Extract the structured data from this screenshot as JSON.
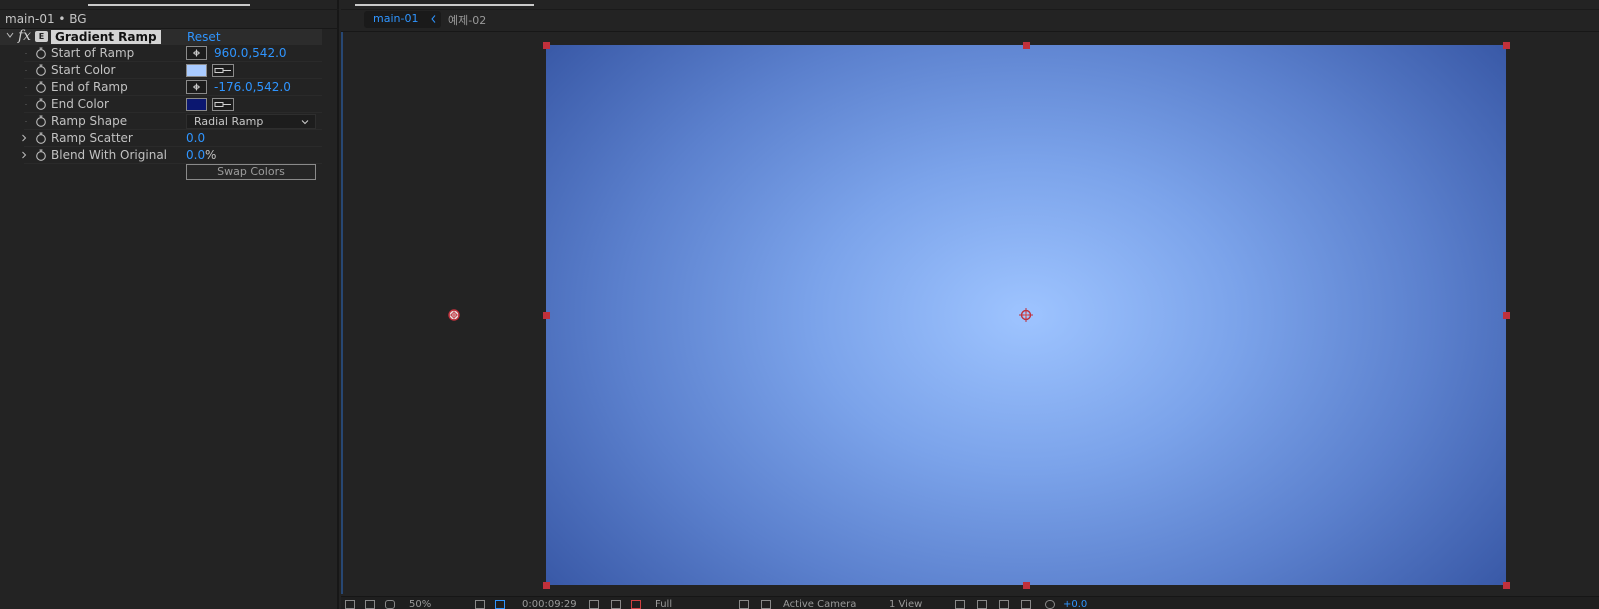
{
  "effect_panel": {
    "layer_title": "main-01 • BG",
    "effect": {
      "name": "Gradient Ramp",
      "reset_label": "Reset",
      "badge": "fx",
      "badge_icon": "effect-badge-icon"
    },
    "properties": {
      "start_of_ramp": {
        "label": "Start of Ramp",
        "value": "960.0,542.0"
      },
      "start_color": {
        "label": "Start Color",
        "color": "#a9cbff"
      },
      "end_of_ramp": {
        "label": "End of Ramp",
        "value": "-176.0,542.0"
      },
      "end_color": {
        "label": "End Color",
        "color": "#0b1770"
      },
      "ramp_shape": {
        "label": "Ramp Shape",
        "value": "Radial Ramp"
      },
      "ramp_scatter": {
        "label": "Ramp Scatter",
        "value": "0.0"
      },
      "blend_with_original": {
        "label": "Blend With Original",
        "value": "0.0",
        "unit": "%"
      }
    },
    "swap_colors_label": "Swap Colors"
  },
  "viewer": {
    "tabs": [
      {
        "label": "main-01",
        "active": true
      },
      {
        "label": "예제-02",
        "active": false
      }
    ],
    "bottom_bar": {
      "zoom": "50%",
      "timecode": "0:00:09:29",
      "resolution": "Full",
      "camera": "Active Camera",
      "views": "1 View",
      "exposure": "+0.0"
    }
  },
  "colors": {
    "accent_blue": "#2f95ff",
    "handle_red": "#c0303b",
    "panel_bg": "#232323"
  }
}
